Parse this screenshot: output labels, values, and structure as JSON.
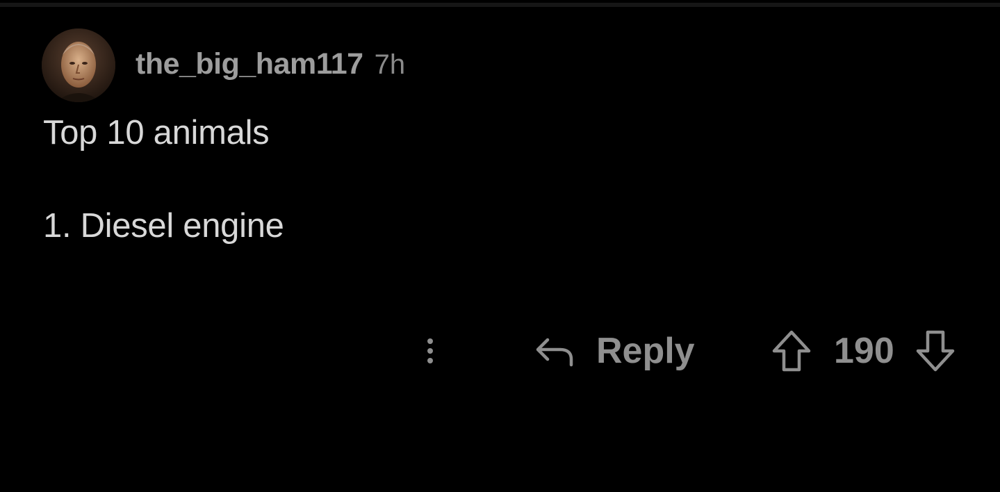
{
  "comment": {
    "username": "the_big_ham117",
    "time_ago": "7h",
    "avatar_icon": "user-avatar",
    "body_lines": [
      "Top 10 animals",
      "1. Diesel engine"
    ]
  },
  "actions": {
    "more_icon": "vertical-ellipsis-icon",
    "reply_icon": "reply-arrow-icon",
    "reply_label": "Reply",
    "upvote_icon": "upvote-arrow-icon",
    "score": "190",
    "downvote_icon": "downvote-arrow-icon"
  },
  "colors": {
    "background": "#000000",
    "body_text": "#d8d8d8",
    "muted_text": "#9d9d9d"
  }
}
